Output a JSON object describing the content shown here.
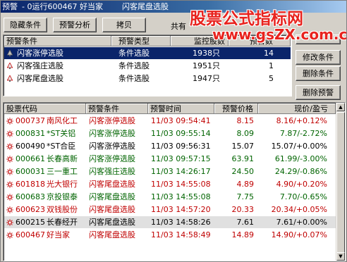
{
  "window": {
    "title_left": "预警",
    "title_mid": "- 0运行600467  好当家",
    "title_right": "闪客尾盘选股"
  },
  "watermark": {
    "line1": "股票公式指标网",
    "line2": "www.gsZX.com.cn"
  },
  "toolbar": {
    "hide_label": "隐藏条件",
    "analyze_label": "预警分析",
    "copy_label": "拷贝",
    "total_label": "共有"
  },
  "conditions": {
    "headers": [
      "预警条件",
      "预警类型",
      "监控股数",
      "预警数"
    ],
    "rows": [
      {
        "name": "闪客涨停选股",
        "type": "条件选股",
        "count": "1938只",
        "alerts": "14"
      },
      {
        "name": "闪客强庄选股",
        "type": "条件选股",
        "count": "1951只",
        "alerts": "1"
      },
      {
        "name": "闪客尾盘选股",
        "type": "条件选股",
        "count": "1947只",
        "alerts": "5"
      }
    ]
  },
  "side_buttons": {
    "add": "",
    "modify": "修改条件",
    "delete": "删除条件",
    "delete_alert": "删除预警"
  },
  "stocks": {
    "headers": [
      "股票代码",
      "预警条件",
      "预警时间",
      "预警价格",
      "现价/盈亏"
    ],
    "rows": [
      {
        "code": "000737",
        "name": "南风化工",
        "cond": "闪客涨停选股",
        "time": "11/03 09:54:41",
        "price": "8.15",
        "current": "8.16/+0.12%",
        "color": "#c00000"
      },
      {
        "code": "000831",
        "name": "*ST关铝",
        "cond": "闪客涨停选股",
        "time": "11/03 09:55:14",
        "price": "8.09",
        "current": "7.87/-2.72%",
        "color": "#006400"
      },
      {
        "code": "600490",
        "name": "*ST合臣",
        "cond": "闪客涨停选股",
        "time": "11/03 09:56:31",
        "price": "15.07",
        "current": "15.07/+0.00%",
        "color": "#000000"
      },
      {
        "code": "000661",
        "name": "长春高新",
        "cond": "闪客涨停选股",
        "time": "11/03 09:57:15",
        "price": "63.91",
        "current": "61.99/-3.00%",
        "color": "#006400"
      },
      {
        "code": "600031",
        "name": "三一重工",
        "cond": "闪客强庄选股",
        "time": "11/03 14:26:17",
        "price": "24.50",
        "current": "24.29/-0.86%",
        "color": "#006400"
      },
      {
        "code": "601818",
        "name": "光大银行",
        "cond": "闪客尾盘选股",
        "time": "11/03 14:55:08",
        "price": "4.89",
        "current": "4.90/+0.20%",
        "color": "#c00000"
      },
      {
        "code": "600683",
        "name": "京投银泰",
        "cond": "闪客尾盘选股",
        "time": "11/03 14:55:08",
        "price": "7.75",
        "current": "7.70/-0.65%",
        "color": "#006400"
      },
      {
        "code": "600623",
        "name": "双钱股份",
        "cond": "闪客尾盘选股",
        "time": "11/03 14:57:20",
        "price": "20.33",
        "current": "20.34/+0.05%",
        "color": "#c00000"
      },
      {
        "code": "600215",
        "name": "长春经开",
        "cond": "闪客尾盘选股",
        "time": "11/03 14:58:26",
        "price": "7.61",
        "current": "7.61/+0.00%",
        "color": "#000000"
      },
      {
        "code": "600467",
        "name": "好当家",
        "cond": "闪客尾盘选股",
        "time": "11/03 14:58:49",
        "price": "14.89",
        "current": "14.90/+0.07%",
        "color": "#c00000"
      }
    ]
  }
}
